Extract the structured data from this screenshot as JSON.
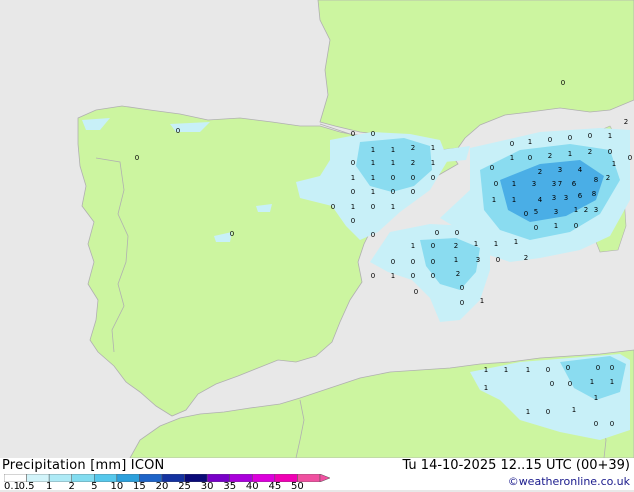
{
  "title": "Precipitation [mm] ICON",
  "valid_time": "Tu 14-10-2025 12..15 UTC (00+39)",
  "credit": "©weatheronline.co.uk",
  "colors": {
    "sea": "#e8e8e8",
    "land": "#ccf5a0",
    "border": "#b0b0b0",
    "precip_light": "#c8f0f8",
    "precip_mid": "#8adcf0",
    "precip_heavy": "#4aaee6"
  },
  "legend": {
    "labels": [
      "0.1",
      "0.5",
      "1",
      "2",
      "5",
      "10",
      "15",
      "20",
      "25",
      "30",
      "35",
      "40",
      "45",
      "50"
    ],
    "colors": [
      "#ffffff",
      "#d2f4fa",
      "#aeeaf6",
      "#82dcf0",
      "#56c8ec",
      "#2ca0dc",
      "#1e64c8",
      "#1432a0",
      "#0a0a78",
      "#7800c8",
      "#aa00dc",
      "#dc00dc",
      "#f000b4",
      "#f050a0"
    ]
  },
  "cells": [
    {
      "v": "0"
    },
    {
      "v": "0"
    },
    {
      "v": "0"
    },
    {
      "v": "0"
    },
    {
      "v": "0"
    },
    {
      "v": "0"
    },
    {
      "v": "1"
    },
    {
      "v": "1"
    },
    {
      "v": "2"
    },
    {
      "v": "1"
    },
    {
      "v": "0"
    },
    {
      "v": "1"
    },
    {
      "v": "1"
    },
    {
      "v": "2"
    },
    {
      "v": "1"
    },
    {
      "v": "1"
    },
    {
      "v": "1"
    },
    {
      "v": "0"
    },
    {
      "v": "0"
    },
    {
      "v": "0"
    },
    {
      "v": "0"
    },
    {
      "v": "1"
    },
    {
      "v": "0"
    },
    {
      "v": "0"
    },
    {
      "v": "0"
    },
    {
      "v": "1"
    },
    {
      "v": "0"
    },
    {
      "v": "1"
    },
    {
      "v": "0"
    },
    {
      "v": "0"
    },
    {
      "v": "1"
    },
    {
      "v": "0"
    },
    {
      "v": "0"
    },
    {
      "v": "0"
    },
    {
      "v": "0"
    },
    {
      "v": "0"
    },
    {
      "v": "0"
    },
    {
      "v": "0"
    },
    {
      "v": "1"
    },
    {
      "v": "2"
    },
    {
      "v": "1"
    },
    {
      "v": "1"
    },
    {
      "v": "0"
    },
    {
      "v": "0"
    },
    {
      "v": "1"
    },
    {
      "v": "2"
    },
    {
      "v": "3"
    },
    {
      "v": "0"
    },
    {
      "v": "0"
    },
    {
      "v": "0"
    },
    {
      "v": "0"
    },
    {
      "v": "1"
    },
    {
      "v": "1"
    },
    {
      "v": "0"
    },
    {
      "v": "1"
    },
    {
      "v": "0"
    },
    {
      "v": "0"
    },
    {
      "v": "0"
    },
    {
      "v": "1"
    },
    {
      "v": "1"
    },
    {
      "v": "2"
    },
    {
      "v": "1"
    },
    {
      "v": "2"
    },
    {
      "v": "0"
    },
    {
      "v": "0"
    },
    {
      "v": "1"
    },
    {
      "v": "2"
    },
    {
      "v": "2"
    },
    {
      "v": "0"
    },
    {
      "v": "0"
    },
    {
      "v": "2"
    },
    {
      "v": "3"
    },
    {
      "v": "4"
    },
    {
      "v": "6"
    },
    {
      "v": "8"
    },
    {
      "v": "0"
    },
    {
      "v": "1"
    },
    {
      "v": "3"
    },
    {
      "v": "3"
    },
    {
      "v": "4"
    },
    {
      "v": "7"
    },
    {
      "v": "8"
    },
    {
      "v": "6"
    },
    {
      "v": "1"
    },
    {
      "v": "1"
    },
    {
      "v": "3"
    },
    {
      "v": "3"
    },
    {
      "v": "2"
    },
    {
      "v": "3"
    },
    {
      "v": "0"
    },
    {
      "v": "3"
    },
    {
      "v": "5"
    },
    {
      "v": "1"
    },
    {
      "v": "1"
    },
    {
      "v": "0"
    },
    {
      "v": "0"
    },
    {
      "v": "2"
    },
    {
      "v": "1"
    },
    {
      "v": "1"
    },
    {
      "v": "1"
    },
    {
      "v": "0"
    },
    {
      "v": "0"
    },
    {
      "v": "0"
    },
    {
      "v": "0"
    },
    {
      "v": "0"
    },
    {
      "v": "0"
    },
    {
      "v": "1"
    },
    {
      "v": "1"
    },
    {
      "v": "1"
    },
    {
      "v": "1"
    },
    {
      "v": "1"
    },
    {
      "v": "0"
    },
    {
      "v": "0"
    },
    {
      "v": "1"
    },
    {
      "v": "0"
    },
    {
      "v": "0"
    },
    {
      "v": "0"
    },
    {
      "v": "0"
    },
    {
      "v": "0"
    },
    {
      "v": "0"
    },
    {
      "v": "0"
    },
    {
      "v": "0"
    },
    {
      "v": "0"
    },
    {
      "v": "0"
    },
    {
      "v": "0"
    }
  ]
}
